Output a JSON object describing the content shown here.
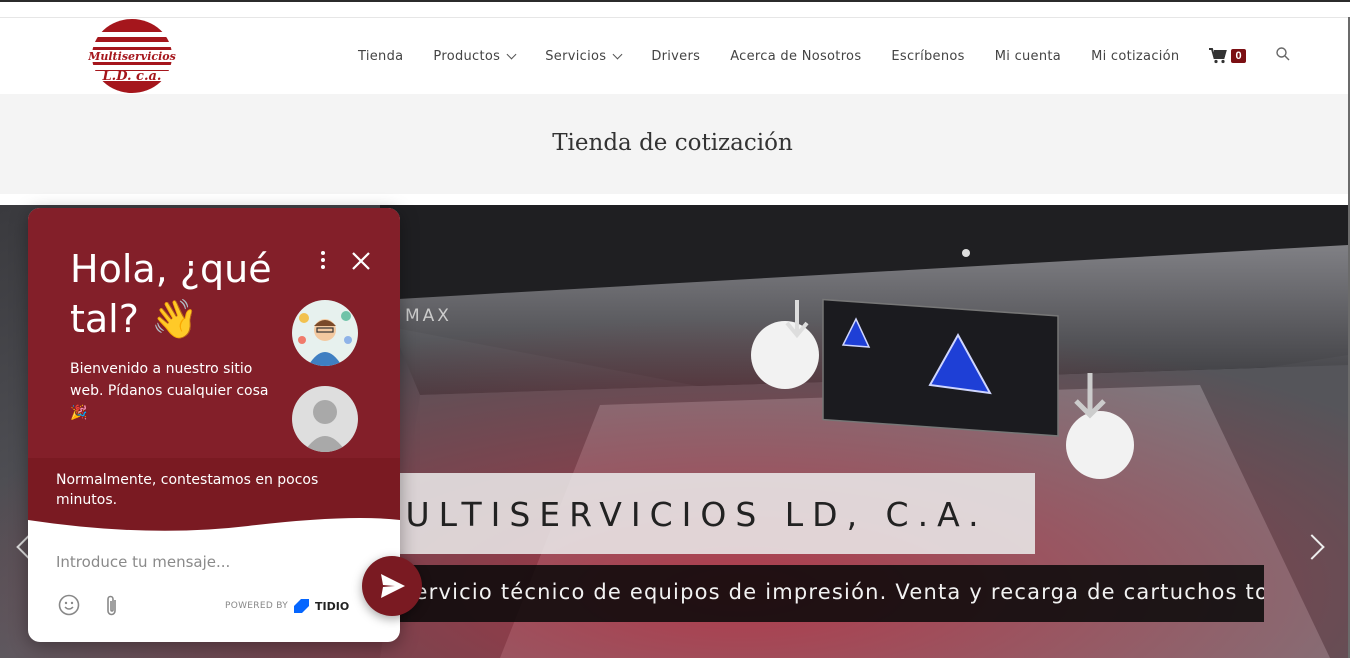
{
  "brand": {
    "logo_text_line1": "Multiservicios",
    "logo_text_line2": "L.D. c.a.",
    "color": "#a5161c"
  },
  "nav": {
    "items": [
      {
        "label": "Tienda",
        "dropdown": false
      },
      {
        "label": "Productos",
        "dropdown": true
      },
      {
        "label": "Servicios",
        "dropdown": true
      },
      {
        "label": "Drivers",
        "dropdown": false
      },
      {
        "label": "Acerca de Nosotros",
        "dropdown": false
      },
      {
        "label": "Escríbenos",
        "dropdown": false
      },
      {
        "label": "Mi cuenta",
        "dropdown": false
      },
      {
        "label": "Mi cotización",
        "dropdown": false
      }
    ],
    "cart_count": "0",
    "cart_icon": "cart-icon",
    "search_icon": "search-icon"
  },
  "page": {
    "title": "Tienda de cotización"
  },
  "hero": {
    "panel_label": "MAX",
    "caption_title": "MULTISERVICIOS LD, C.A.",
    "caption_subtitle": "Servicio técnico de equipos de impresión. Venta y recarga de cartuchos toner"
  },
  "chat": {
    "greeting": "Hola, ¿qué tal? 👋",
    "welcome": "Bienvenido a nuestro sitio web. Pídanos cualquier cosa 🎉",
    "response_time": "Normalmente, contestamos en pocos minutos.",
    "input_placeholder": "Introduce tu mensaje...",
    "powered_by": "POWERED BY",
    "provider": "TIDIO",
    "accent": "#7a1a22"
  }
}
